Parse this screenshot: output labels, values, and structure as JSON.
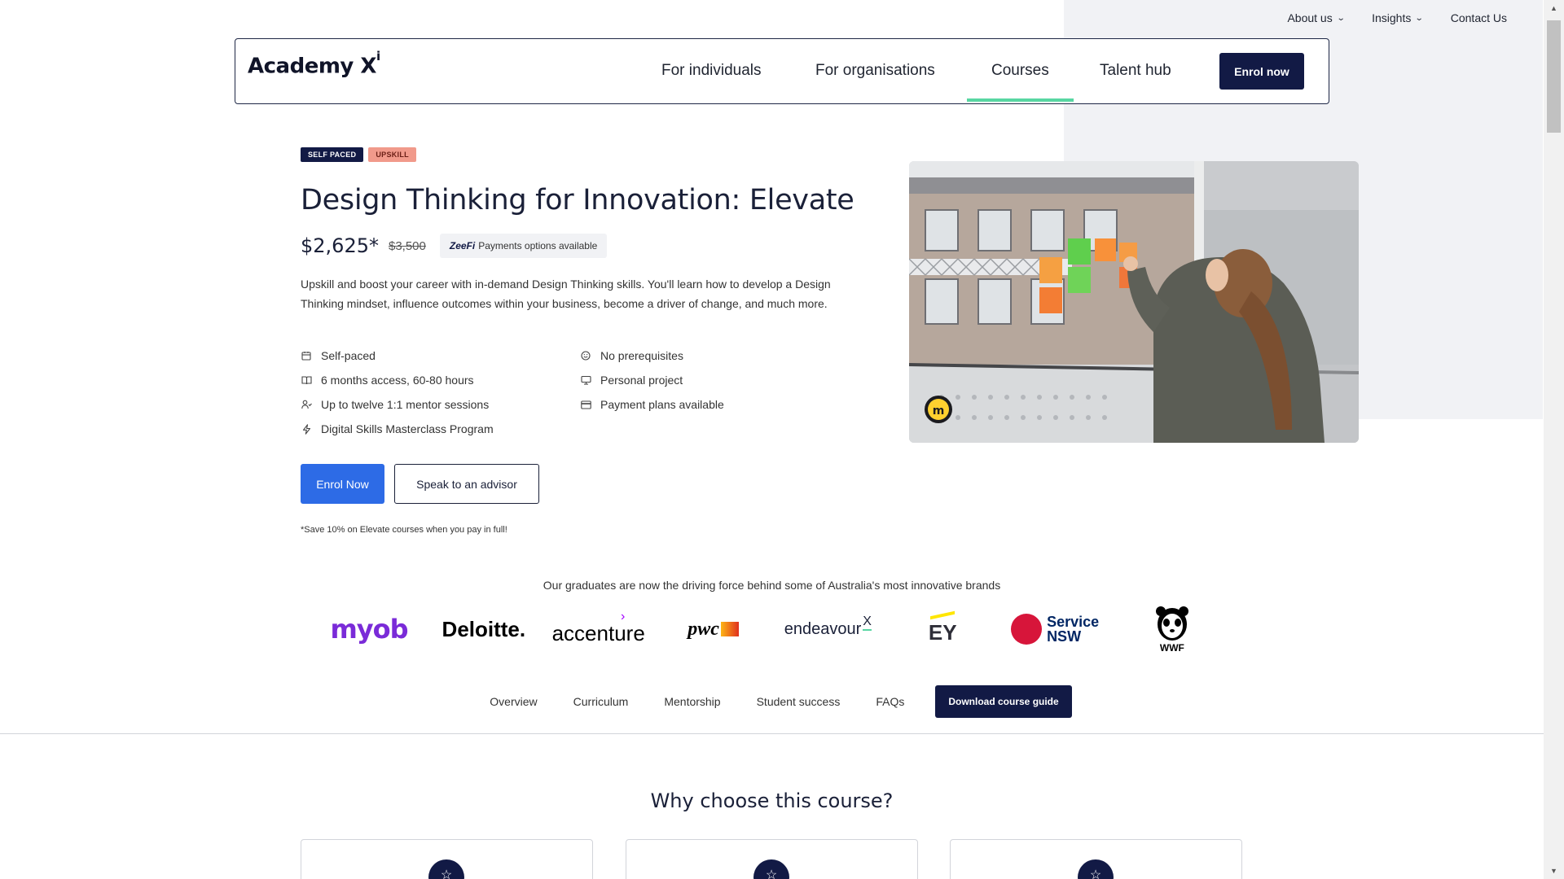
{
  "topbar": {
    "about": "About us",
    "insights": "Insights",
    "contact": "Contact Us"
  },
  "nav": {
    "logo": "Academy X",
    "logo_sup": "i",
    "links": [
      "For individuals",
      "For organisations",
      "Courses",
      "Talent hub"
    ],
    "active": "Courses",
    "enrol": "Enrol now"
  },
  "course": {
    "badges": [
      "SELF PACED",
      "UPSKILL"
    ],
    "title": "Design Thinking for Innovation: Elevate",
    "price": "$2,625*",
    "old_price": "$3,500",
    "zeefi_brand": "ZeeFi",
    "zeefi_text": "Payments options available",
    "description": "Upskill and boost your career with in-demand Design Thinking skills. You'll learn how to develop a Design Thinking mindset, influence outcomes within your business, become a driver of change, and much more.",
    "features_left": [
      {
        "icon": "calendar-icon",
        "label": "Self-paced"
      },
      {
        "icon": "book-icon",
        "label": "6 months access, 60-80 hours"
      },
      {
        "icon": "mentor-icon",
        "label": "Up to twelve 1:1 mentor sessions"
      },
      {
        "icon": "lightning-icon",
        "label": "Digital Skills Masterclass Program"
      }
    ],
    "features_right": [
      {
        "icon": "smile-icon",
        "label": "No prerequisites"
      },
      {
        "icon": "monitor-icon",
        "label": "Personal project"
      },
      {
        "icon": "card-icon",
        "label": "Payment plans available"
      }
    ],
    "enrol_button": "Enrol Now",
    "advisor_button": "Speak to an advisor",
    "note": "*Save 10% on Elevate courses when you pay in full!"
  },
  "graduates": {
    "heading": "Our graduates are now the driving force behind some of Australia's most innovative brands",
    "brands": [
      "myob",
      "Deloitte.",
      "accenture",
      "pwc",
      "endeavour",
      "EY",
      "Service NSW",
      "WWF"
    ]
  },
  "tabs": {
    "items": [
      "Overview",
      "Curriculum",
      "Mentorship",
      "Student success",
      "FAQs"
    ],
    "download": "Download course guide"
  },
  "why": {
    "heading": "Why choose this course?"
  },
  "colors": {
    "navy": "#121a45",
    "blue": "#2d6be6",
    "green_underline": "#58d6a2",
    "badge_pink": "#f19a8b"
  }
}
